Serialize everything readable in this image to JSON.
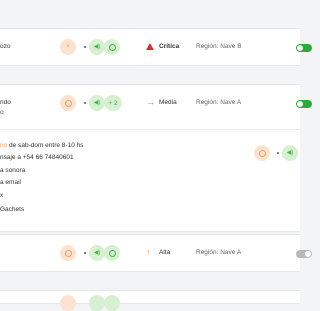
{
  "rows": [
    {
      "name": "ozo",
      "priority": {
        "label": "Crítica",
        "icon": "warning-triangle-icon",
        "color": "#d32f2f"
      },
      "region": "Región: Nave B",
      "enabled": true
    },
    {
      "name": "ndo",
      "more_channels": "+ 2",
      "priority": {
        "label": "Media",
        "icon": "arrow-right-icon",
        "color": "#4caf50"
      },
      "region": "Región: Nave A",
      "enabled": true
    },
    {
      "priority": {
        "label": "Alta",
        "icon": "arrow-up-icon",
        "color": "#f39c3d"
      },
      "region": "Región: Nave A",
      "enabled": false
    }
  ],
  "detail": {
    "line1_highlight": "rio",
    "line1_rest": "de sab-dom entre 8-10 hs",
    "line2": "nsaje a +54 66 74840601",
    "line3": "a sonora",
    "line4": "a email",
    "line5": "x",
    "line6": "Gachets"
  },
  "colors": {
    "accent_orange": "#f0a060",
    "accent_green": "#4caf50",
    "toggle_on": "#2eaa3a",
    "toggle_off": "#b9b9b9"
  }
}
